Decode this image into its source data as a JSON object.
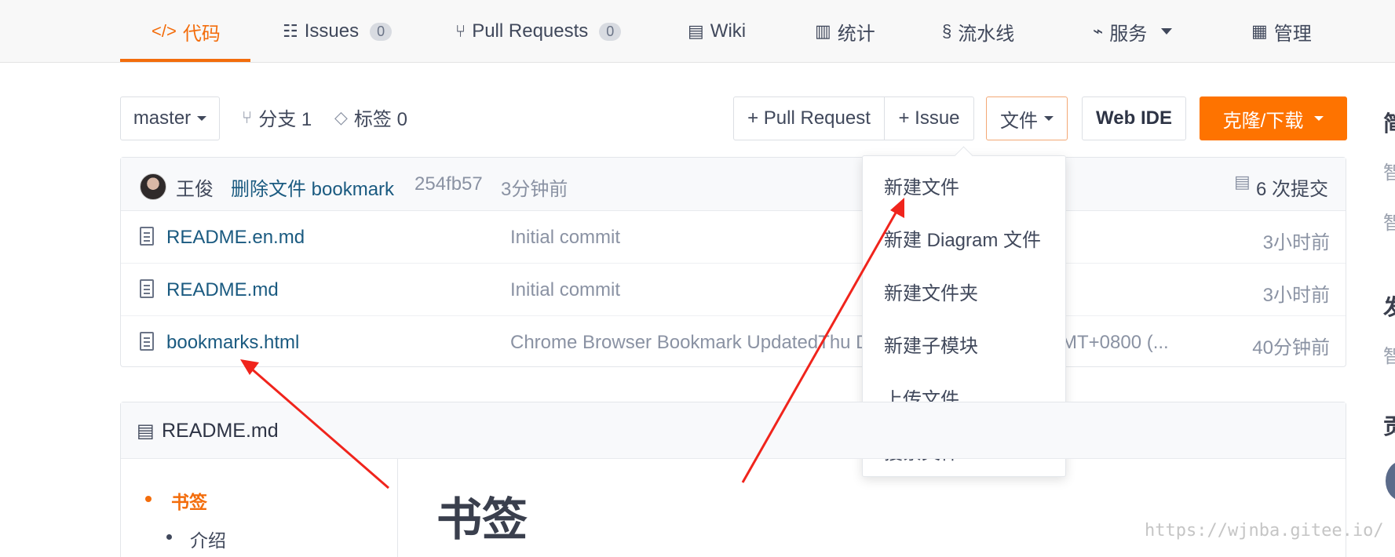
{
  "nav": {
    "tabs": [
      {
        "label": "代码",
        "icon": "code-icon",
        "active": true
      },
      {
        "label": "Issues",
        "icon": "issues-icon",
        "count": "0"
      },
      {
        "label": "Pull Requests",
        "icon": "pull-request-icon",
        "count": "0"
      },
      {
        "label": "Wiki",
        "icon": "book-icon"
      },
      {
        "label": "统计",
        "icon": "bar-chart-icon"
      },
      {
        "label": "流水线",
        "icon": "pipeline-icon"
      },
      {
        "label": "服务",
        "icon": "pulse-icon",
        "dropdown": true
      },
      {
        "label": "管理",
        "icon": "settings-doc-icon"
      }
    ]
  },
  "toolbar": {
    "branch": "master",
    "branches_label": "分支 1",
    "tags_label": "标签 0",
    "pull_request_button": "+ Pull Request",
    "issue_button": "+ Issue",
    "file_button": "文件",
    "webide_button": "Web IDE",
    "clone_button": "克隆/下载"
  },
  "commit": {
    "author": "王俊",
    "message": "删除文件 bookmark",
    "hash": "254fb57",
    "time": "3分钟前",
    "commits_label": "6 次提交"
  },
  "files": [
    {
      "name": "README.en.md",
      "message": "Initial commit",
      "time": "3小时前"
    },
    {
      "name": "README.md",
      "message": "Initial commit",
      "time": "3小时前"
    },
    {
      "name": "bookmarks.html",
      "message": "Chrome Browser Bookmark UpdatedThu D",
      "message_tail": "MT+0800 (...",
      "time": "40分钟前"
    }
  ],
  "file_menu": {
    "items": [
      "新建文件",
      "新建 Diagram 文件",
      "新建文件夹",
      "新建子模块",
      "上传文件",
      "搜索文件"
    ]
  },
  "readme": {
    "title": "README.md",
    "toc": [
      "书签",
      "介绍"
    ],
    "heading": "书签"
  },
  "watermark": "https://wjnba.gitee.io/",
  "colors": {
    "accent": "#f36d0c",
    "link": "#1a5a80",
    "arrow": "#f0241c"
  }
}
